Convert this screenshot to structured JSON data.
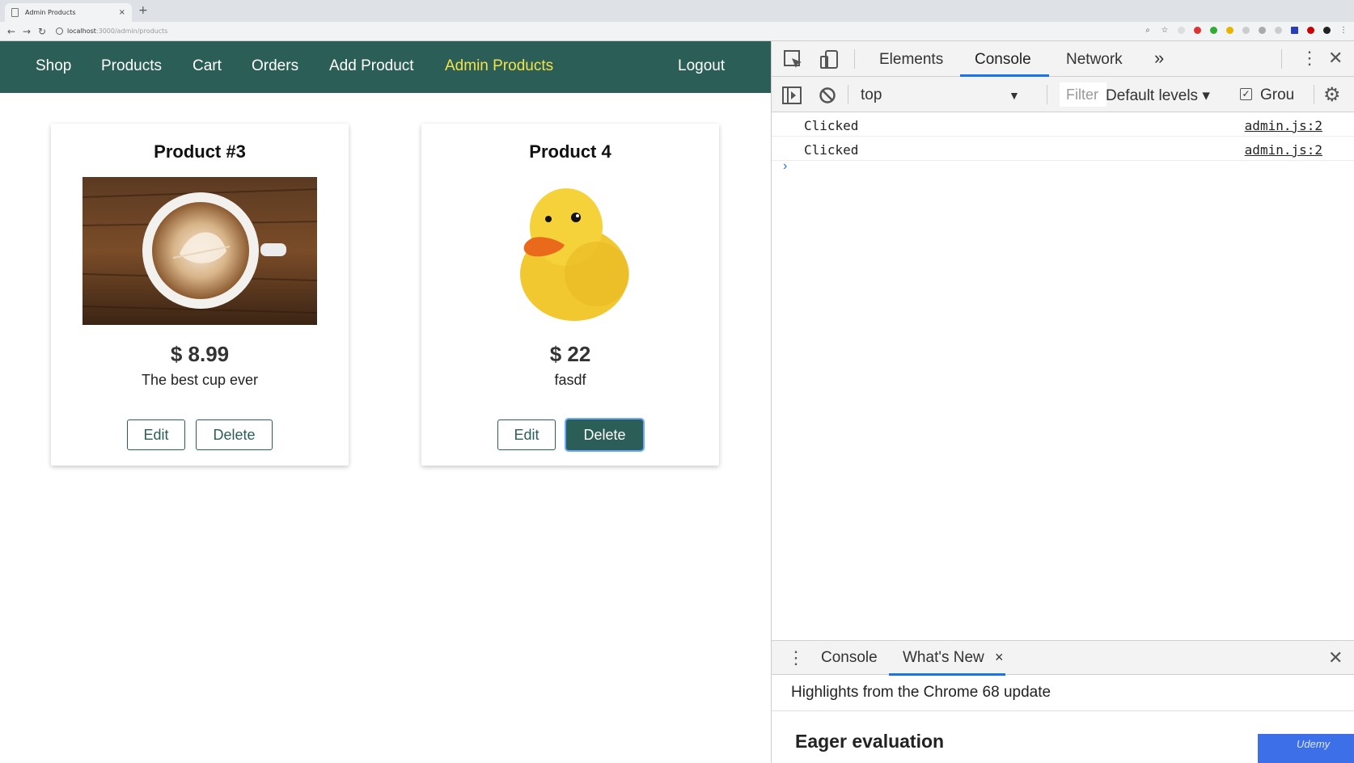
{
  "browser": {
    "tab_title": "Admin Products",
    "tab_close": "×",
    "new_tab": "+",
    "url_host": "localhost",
    "url_path": ":3000/admin/products"
  },
  "nav": {
    "items": [
      {
        "label": "Shop",
        "active": false
      },
      {
        "label": "Products",
        "active": false
      },
      {
        "label": "Cart",
        "active": false
      },
      {
        "label": "Orders",
        "active": false
      },
      {
        "label": "Add Product",
        "active": false
      },
      {
        "label": "Admin Products",
        "active": true
      }
    ],
    "logout": "Logout",
    "bg_color": "#2b5e56",
    "active_color": "#f4e34a"
  },
  "products": [
    {
      "title": "Product #3",
      "image": "coffee-cup",
      "price": "$ 8.99",
      "description": "The best cup ever",
      "edit_label": "Edit",
      "delete_label": "Delete",
      "delete_pressed": false
    },
    {
      "title": "Product 4",
      "image": "rubber-duck",
      "price": "$ 22",
      "description": "fasdf",
      "edit_label": "Edit",
      "delete_label": "Delete",
      "delete_pressed": true
    }
  ],
  "devtools": {
    "tabs": [
      "Elements",
      "Console",
      "Network"
    ],
    "active_tab": "Console",
    "more": "»",
    "context": "top",
    "filter_placeholder": "Filter",
    "levels": "Default levels ▾",
    "group_label": "Grou",
    "logs": [
      {
        "message": "Clicked",
        "source": "admin.js:2"
      },
      {
        "message": "Clicked",
        "source": "admin.js:2"
      }
    ],
    "prompt": "›",
    "drawer": {
      "tabs": [
        "Console",
        "What's New"
      ],
      "active_tab": "What's New",
      "close": "×",
      "highlights": "Highlights from the Chrome 68 update",
      "section": "Eager evaluation"
    },
    "watermark": "Udemy"
  }
}
